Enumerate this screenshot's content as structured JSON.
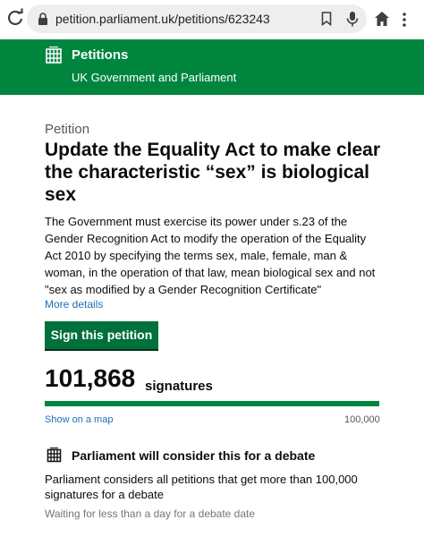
{
  "browser": {
    "url": "petition.parliament.uk/petitions/623243",
    "icons": [
      "reload-icon",
      "lock-icon",
      "bookmark-icon",
      "mic-icon",
      "home-icon",
      "more-vert-icon"
    ]
  },
  "header": {
    "title": "Petitions",
    "subtitle": "UK Government and Parliament",
    "color": "#00853f"
  },
  "petition": {
    "caption": "Petition",
    "title": "Update the Equality Act to make clear the characteristic “sex” is biological sex",
    "summary": "The Government must exercise its power under s.23 of the Gender Recognition Act to modify the operation of the Equality Act 2010 by specifying the terms sex, male, female, man & woman, in the operation of that law, mean biological sex and not \"sex as modified by a Gender Recognition Certificate\"",
    "more_details": "More details",
    "sign_label": "Sign this petition"
  },
  "signatures": {
    "count": "101,868",
    "label": "signatures",
    "progress_fraction": 1.0,
    "map_link": "Show on a map",
    "goal": "100,000"
  },
  "debate": {
    "title": "Parliament will consider this for a debate",
    "text": "Parliament considers all petitions that get more than 100,000 signatures for a debate",
    "waiting": "Waiting for less than a day for a debate date"
  },
  "colors": {
    "accent_green": "#00853f",
    "button_green": "#00703c",
    "link_blue": "#1d70b8",
    "secondary_text": "#505a5f"
  }
}
